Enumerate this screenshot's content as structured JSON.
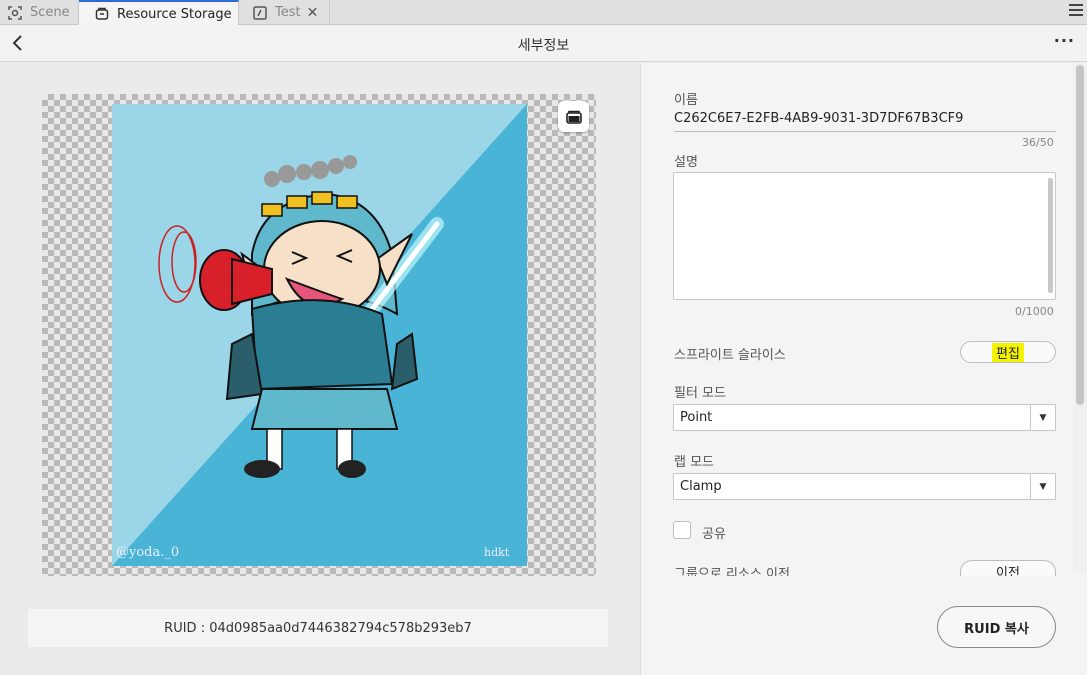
{
  "tabs": [
    {
      "label": "Scene",
      "icon": "scene-icon",
      "active": false
    },
    {
      "label": "Resource Storage",
      "icon": "storage-icon",
      "active": true
    },
    {
      "label": "Test",
      "icon": "script-icon",
      "active": false,
      "closable": true
    }
  ],
  "header": {
    "title": "세부정보",
    "more": "···"
  },
  "preview": {
    "watermark_left": "@yoda._0",
    "watermark_right": "hdkt"
  },
  "ruid_text": "RUID : 04d0985aa0d7446382794c578b293eb7",
  "form": {
    "name_label": "이름",
    "name_value": "C262C6E7-E2FB-4AB9-9031-3D7DF67B3CF9",
    "name_counter": "36/50",
    "desc_label": "설명",
    "desc_value": "",
    "desc_counter": "0/1000",
    "sprite_slice_label": "스프라이트 슬라이스",
    "edit_label": "편집",
    "filter_label": "필터 모드",
    "filter_value": "Point",
    "wrap_label": "랩 모드",
    "wrap_value": "Clamp",
    "share_label": "공유",
    "move_group_label": "그룹으로 리소스 이전",
    "move_button": "이전",
    "copy_button": "RUID 복사"
  },
  "colors": {
    "accent": "#2a6bd6",
    "highlight": "#f4f400",
    "art_light": "#9ad5e8",
    "art_dark": "#4ab4d6"
  }
}
